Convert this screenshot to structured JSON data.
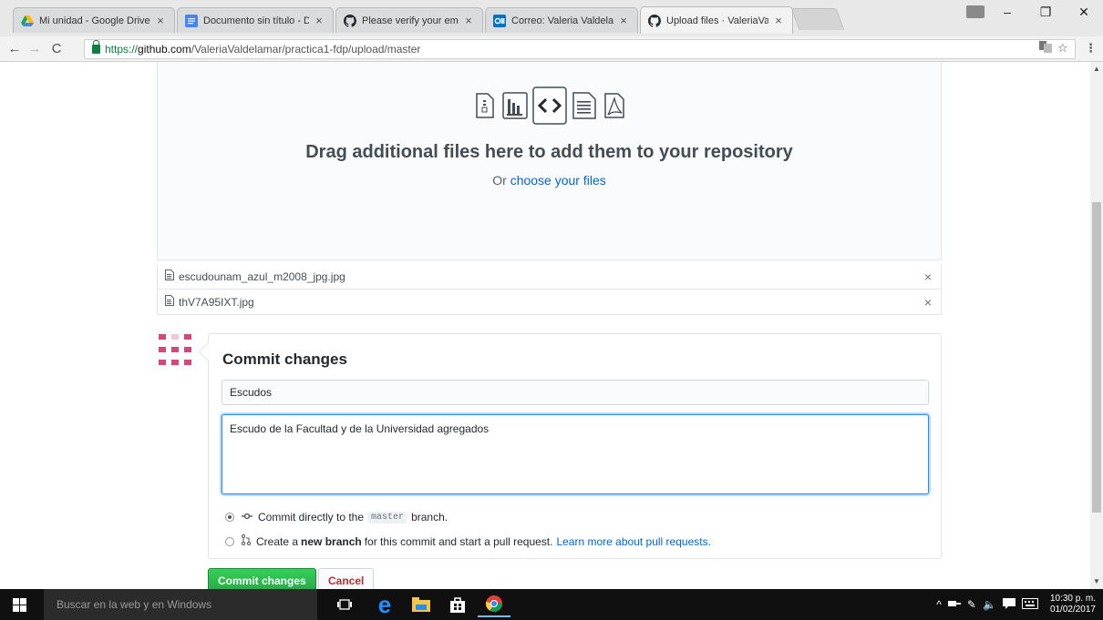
{
  "browser": {
    "tabs": [
      {
        "title": "Mi unidad - Google Drive",
        "icon": "google-drive-icon",
        "color": "#1fa463"
      },
      {
        "title": "Documento sin título - Documentos",
        "icon": "google-docs-icon",
        "color": "#4285f4"
      },
      {
        "title": "Please verify your email address",
        "icon": "github-icon",
        "color": "#24292e"
      },
      {
        "title": "Correo: Valeria Valdelamar",
        "icon": "outlook-icon",
        "color": "#0072c6"
      },
      {
        "title": "Upload files · ValeriaValdelamar",
        "icon": "github-icon",
        "color": "#24292e",
        "active": true
      }
    ],
    "close_glyph": "×",
    "url": {
      "scheme": "https://",
      "host": "github.com",
      "path": "/ValeriaValdelamar/practica1-fdp/upload/master"
    }
  },
  "dropzone": {
    "title": "Drag additional files here to add them to your repository",
    "sub_prefix": "Or ",
    "sub_link": "choose your files"
  },
  "files": [
    {
      "name": "escudounam_azul_m2008_jpg.jpg"
    },
    {
      "name": "thV7A95IXT.jpg"
    }
  ],
  "commit": {
    "title": "Commit changes",
    "summary_value": "Escudos",
    "description_value": "Escudo de la Facultad y de la Universidad agregados",
    "option_direct_prefix": "Commit directly to the",
    "branch_name": "master",
    "option_direct_suffix": "branch.",
    "option_new_prefix": "Create a",
    "option_new_bold": "new branch",
    "option_new_suffix": "for this commit and start a pull request.",
    "option_new_link": "Learn more about pull requests.",
    "submit_label": "Commit changes",
    "cancel_label": "Cancel"
  },
  "taskbar": {
    "search_placeholder": "Buscar en la web y en Windows",
    "time": "10:30 p. m.",
    "date": "01/02/2017"
  },
  "colors": {
    "accent_link": "#0366d6",
    "commit_green": "#28a745",
    "cancel_red": "#cb2431",
    "avatar_pink": "#d4477b"
  }
}
